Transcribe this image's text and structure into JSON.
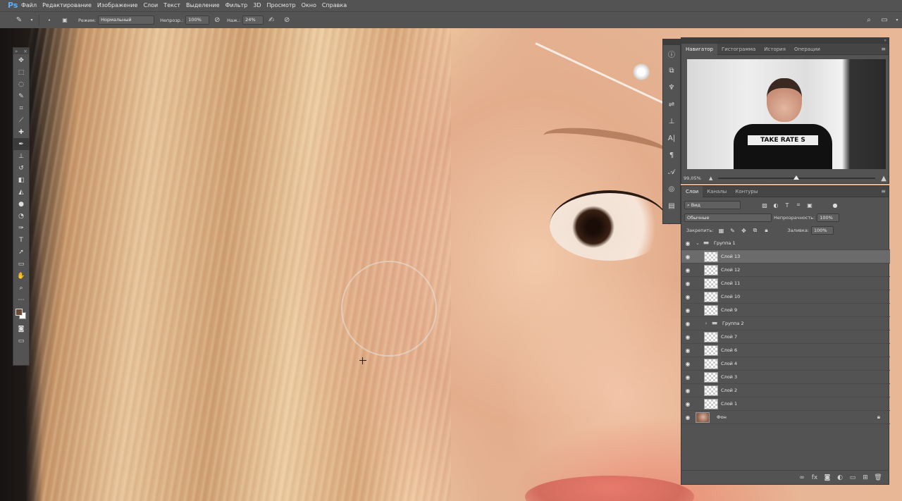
{
  "app": {
    "logo": "Ps"
  },
  "menu": [
    "Файл",
    "Редактирование",
    "Изображение",
    "Слои",
    "Текст",
    "Выделение",
    "Фильтр",
    "3D",
    "Просмотр",
    "Окно",
    "Справка"
  ],
  "options": {
    "mode_label": "Режим:",
    "mode_value": "Нормальный",
    "opacity_label": "Непрозр.:",
    "opacity_value": "100%",
    "pressure_label": "Наж.:",
    "pressure_value": "24%"
  },
  "tools": [
    "move-tool-icon",
    "marquee-tool-icon",
    "lasso-tool-icon",
    "quick-select-tool-icon",
    "crop-tool-icon",
    "eyedropper-tool-icon",
    "healing-brush-tool-icon",
    "brush-tool-icon",
    "clone-stamp-tool-icon",
    "history-brush-tool-icon",
    "eraser-tool-icon",
    "paint-bucket-tool-icon",
    "blur-tool-icon",
    "dodge-tool-icon",
    "pen-tool-icon",
    "type-tool-icon",
    "path-select-tool-icon",
    "shape-tool-icon",
    "hand-tool-icon",
    "zoom-tool-icon",
    "more-tools-icon"
  ],
  "colors": {
    "foreground": "#6b4a36",
    "background": "#ffffff",
    "accent": "#31a8ff"
  },
  "navigator": {
    "tabs": [
      "Навигатор",
      "Гистограмма",
      "История",
      "Операции"
    ],
    "zoom": "99,05%",
    "preview_text": "TAKE RATE S"
  },
  "layers_panel": {
    "tabs": [
      "Слои",
      "Каналы",
      "Контуры"
    ],
    "filter_kind": "Вид",
    "blend_mode": "Обычные",
    "opacity_label": "Непрозрачность:",
    "opacity_value": "100%",
    "lock_label": "Закрепить:",
    "fill_label": "Заливка:",
    "fill_value": "100%",
    "layers": [
      {
        "name": "Группа 1",
        "type": "group",
        "expanded": true,
        "level": 0
      },
      {
        "name": "Слой 13",
        "type": "layer",
        "level": 1,
        "selected": true
      },
      {
        "name": "Слой 12",
        "type": "layer",
        "level": 1
      },
      {
        "name": "Слой 11",
        "type": "layer",
        "level": 1
      },
      {
        "name": "Слой 10",
        "type": "layer",
        "level": 1
      },
      {
        "name": "Слой 9",
        "type": "layer",
        "level": 1
      },
      {
        "name": "Группа 2",
        "type": "group",
        "expanded": false,
        "level": 1
      },
      {
        "name": "Слой 7",
        "type": "layer",
        "level": 1
      },
      {
        "name": "Слой 6",
        "type": "layer",
        "level": 1
      },
      {
        "name": "Слой 4",
        "type": "layer",
        "level": 1
      },
      {
        "name": "Слой 3",
        "type": "layer",
        "level": 1
      },
      {
        "name": "Слой 2",
        "type": "layer",
        "level": 1
      },
      {
        "name": "Слой 1",
        "type": "layer",
        "level": 1
      },
      {
        "name": "Фон",
        "type": "background",
        "level": 0,
        "locked": true
      }
    ]
  }
}
